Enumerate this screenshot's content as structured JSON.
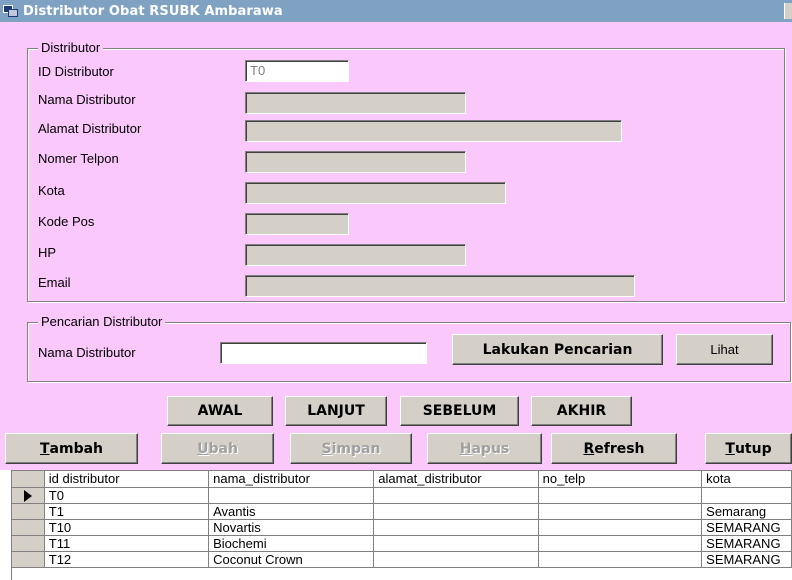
{
  "window": {
    "title": "Distributor Obat RSUBK Ambarawa"
  },
  "distributor_group": {
    "legend": "Distributor",
    "fields": [
      {
        "label": "ID Distributor",
        "value": "T0"
      },
      {
        "label": "Nama Distributor",
        "value": ""
      },
      {
        "label": "Alamat Distributor",
        "value": ""
      },
      {
        "label": "Nomer Telpon",
        "value": ""
      },
      {
        "label": "Kota",
        "value": ""
      },
      {
        "label": "Kode Pos",
        "value": ""
      },
      {
        "label": "HP",
        "value": ""
      },
      {
        "label": "Email",
        "value": ""
      }
    ]
  },
  "search_group": {
    "legend": "Pencarian Distributor",
    "label": "Nama Distributor",
    "value": "",
    "search_button": "Lakukan Pencarian",
    "view_button": "Lihat"
  },
  "navigation": {
    "first": "AWAL",
    "next": "LANJUT",
    "previous": "SEBELUM",
    "last": "AKHIR"
  },
  "actions": {
    "add": {
      "mnemonic": "T",
      "rest": "ambah"
    },
    "edit": {
      "mnemonic": "U",
      "rest": "bah"
    },
    "save": {
      "mnemonic": "S",
      "rest": "impan"
    },
    "delete": {
      "mnemonic": "H",
      "rest": "apus"
    },
    "refresh": {
      "mnemonic": "R",
      "rest": "efresh"
    },
    "close": {
      "mnemonic": "T",
      "rest": "utup"
    }
  },
  "grid": {
    "columns": [
      "id distributor",
      "nama_distributor",
      "alamat_distributor",
      "no_telp",
      "kota"
    ],
    "rows": [
      [
        "T0",
        "",
        "",
        "",
        ""
      ],
      [
        "T1",
        "Avantis",
        "",
        "",
        "Semarang"
      ],
      [
        "T10",
        "Novartis",
        "",
        "",
        "SEMARANG"
      ],
      [
        "T11",
        "Biochemi",
        "",
        "",
        "SEMARANG"
      ],
      [
        "T12",
        "Coconut Crown",
        "",
        "",
        "SEMARANG"
      ]
    ],
    "current_row": 0
  }
}
